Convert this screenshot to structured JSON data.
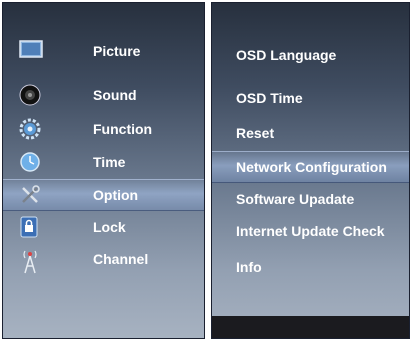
{
  "left_menu": {
    "items": [
      {
        "label": "Picture",
        "icon": "picture-icon"
      },
      {
        "label": "Sound",
        "icon": "speaker-icon"
      },
      {
        "label": "Function",
        "icon": "gear-icon"
      },
      {
        "label": "Time",
        "icon": "clock-icon"
      },
      {
        "label": "Option",
        "icon": "tools-icon",
        "selected": true
      },
      {
        "label": "Lock",
        "icon": "lock-icon"
      },
      {
        "label": "Channel",
        "icon": "antenna-icon"
      }
    ]
  },
  "right_menu": {
    "items": [
      {
        "label": "OSD Language"
      },
      {
        "label": "OSD Time"
      },
      {
        "label": "Reset"
      },
      {
        "label": "Network Configuration",
        "selected": true
      },
      {
        "label": "Software Upadate"
      },
      {
        "label": "Internet Update Check"
      },
      {
        "label": "Info"
      }
    ]
  },
  "colors": {
    "highlight": "#a8bde0",
    "text": "#ffffff",
    "bottom_strip": "#1b1b1f"
  }
}
